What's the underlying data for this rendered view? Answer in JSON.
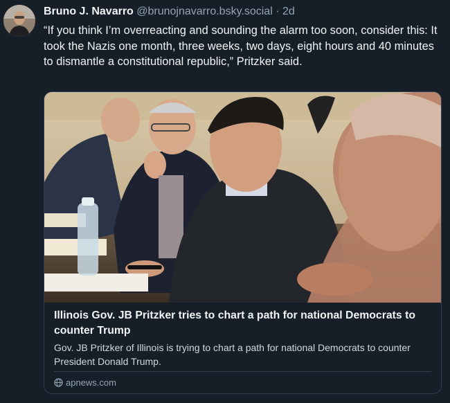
{
  "post": {
    "author": {
      "display_name": "Bruno J. Navarro",
      "handle": "@brunojnavarro.bsky.social",
      "separator": "·",
      "timestamp": "2d"
    },
    "text": "“If you think I’m overreacting and sounding the alarm too soon, consider this: It took the Nazis one month, three weeks, two days, eight hours and 40 minutes to dismantle a constitutional republic,” Pritzker said.",
    "embed": {
      "title": "Illinois Gov. JB Pritzker tries to chart a path for national Democrats to counter Trump",
      "description": "Gov. JB Pritzker of Illinois is trying to chart a path for national Democrats to counter President Donald Trump.",
      "source": "apnews.com",
      "source_icon": "globe-icon"
    }
  },
  "colors": {
    "background": "#161e27",
    "text_primary": "#f1f3f5",
    "text_secondary": "#93a5b7",
    "border": "#2e4052"
  }
}
